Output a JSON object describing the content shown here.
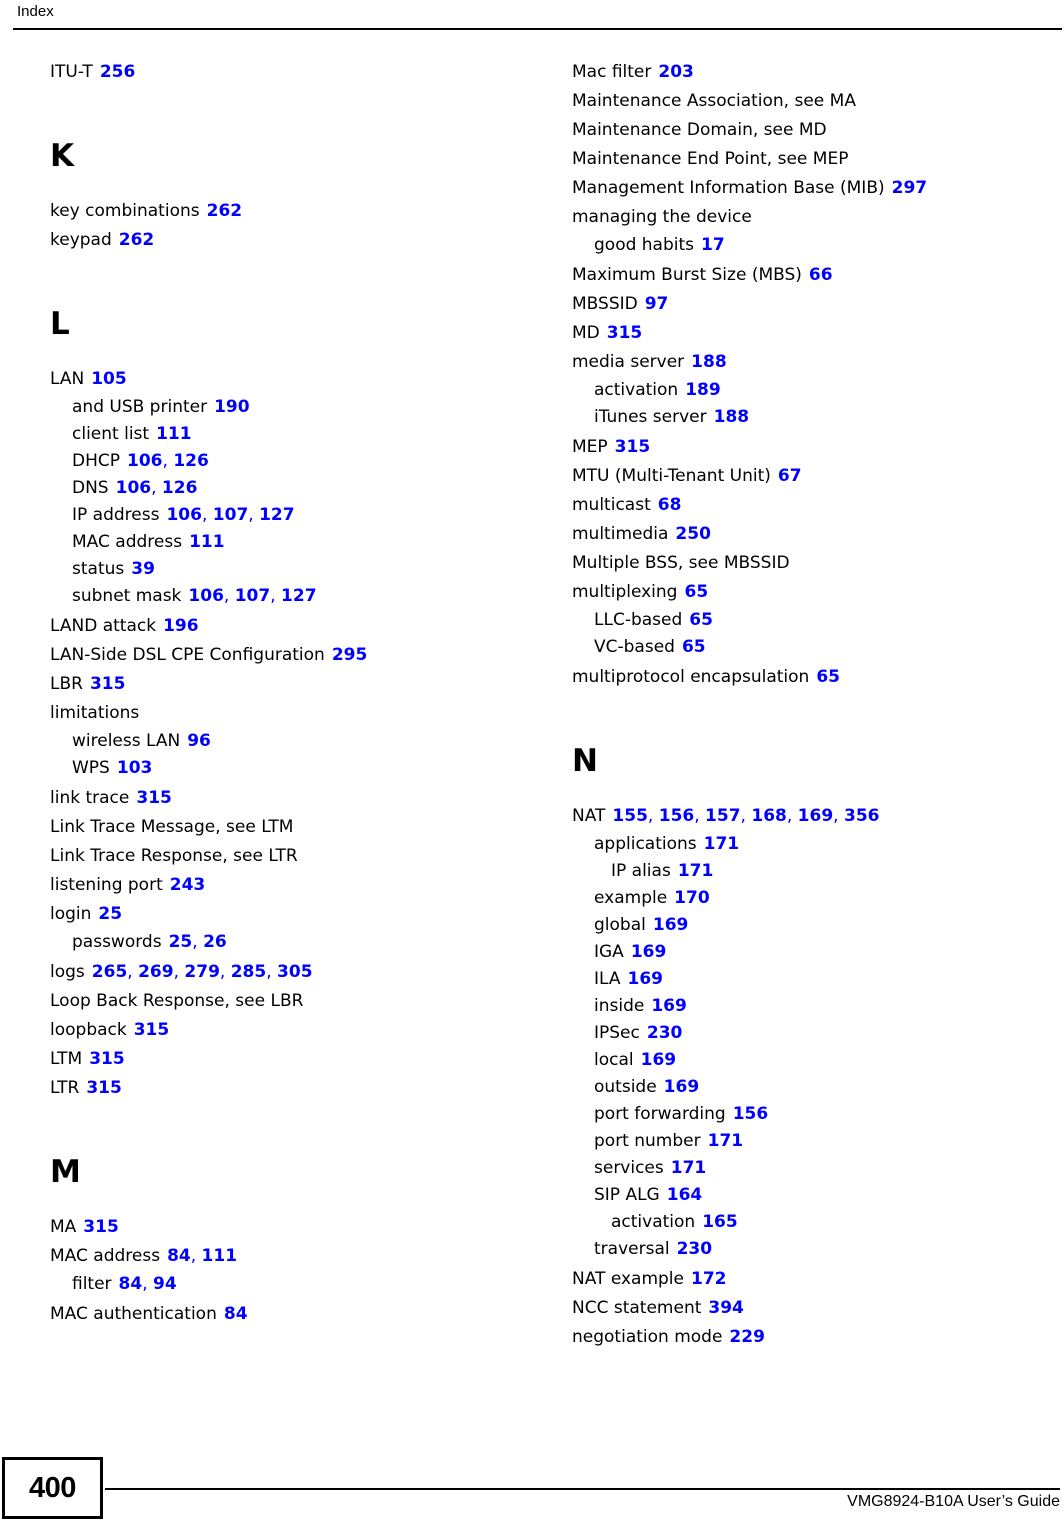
{
  "header": {
    "title": "Index"
  },
  "footer": {
    "page_number": "400",
    "guide_title": "VMG8924-B10A User’s Guide"
  },
  "columns": [
    {
      "name": "left-column",
      "blocks": [
        {
          "type": "entries",
          "entries": [
            {
              "level": 0,
              "term": "ITU-T",
              "refs": [
                "256"
              ]
            }
          ]
        },
        {
          "type": "letter",
          "letter": "K",
          "entries": [
            {
              "level": 0,
              "term": "key combinations",
              "refs": [
                "262"
              ]
            },
            {
              "level": 0,
              "term": "keypad",
              "refs": [
                "262"
              ]
            }
          ]
        },
        {
          "type": "letter",
          "letter": "L",
          "entries": [
            {
              "level": 0,
              "term": "LAN",
              "refs": [
                "105"
              ]
            },
            {
              "level": 1,
              "term": "and USB printer",
              "refs": [
                "190"
              ]
            },
            {
              "level": 1,
              "term": "client list",
              "refs": [
                "111"
              ]
            },
            {
              "level": 1,
              "term": "DHCP",
              "refs": [
                "106",
                "126"
              ]
            },
            {
              "level": 1,
              "term": "DNS",
              "refs": [
                "106",
                "126"
              ]
            },
            {
              "level": 1,
              "term": "IP address",
              "refs": [
                "106",
                "107",
                "127"
              ]
            },
            {
              "level": 1,
              "term": "MAC address",
              "refs": [
                "111"
              ]
            },
            {
              "level": 1,
              "term": "status",
              "refs": [
                "39"
              ]
            },
            {
              "level": 1,
              "term": "subnet mask",
              "refs": [
                "106",
                "107",
                "127"
              ]
            },
            {
              "level": 0,
              "term": "LAND attack",
              "refs": [
                "196"
              ]
            },
            {
              "level": 0,
              "term": "LAN-Side DSL CPE Configuration",
              "refs": [
                "295"
              ]
            },
            {
              "level": 0,
              "term": "LBR",
              "refs": [
                "315"
              ]
            },
            {
              "level": 0,
              "term": "limitations",
              "refs": []
            },
            {
              "level": 1,
              "term": "wireless LAN",
              "refs": [
                "96"
              ]
            },
            {
              "level": 1,
              "term": "WPS",
              "refs": [
                "103"
              ]
            },
            {
              "level": 0,
              "term": "link trace",
              "refs": [
                "315"
              ]
            },
            {
              "level": 0,
              "term": "Link Trace Message, see LTM",
              "refs": []
            },
            {
              "level": 0,
              "term": "Link Trace Response, see LTR",
              "refs": []
            },
            {
              "level": 0,
              "term": "listening port",
              "refs": [
                "243"
              ]
            },
            {
              "level": 0,
              "term": "login",
              "refs": [
                "25"
              ]
            },
            {
              "level": 1,
              "term": "passwords",
              "refs": [
                "25",
                "26"
              ]
            },
            {
              "level": 0,
              "term": "logs",
              "refs": [
                "265",
                "269",
                "279",
                "285",
                "305"
              ]
            },
            {
              "level": 0,
              "term": "Loop Back Response, see LBR",
              "refs": []
            },
            {
              "level": 0,
              "term": "loopback",
              "refs": [
                "315"
              ]
            },
            {
              "level": 0,
              "term": "LTM",
              "refs": [
                "315"
              ]
            },
            {
              "level": 0,
              "term": "LTR",
              "refs": [
                "315"
              ]
            }
          ]
        },
        {
          "type": "letter",
          "letter": "M",
          "entries": [
            {
              "level": 0,
              "term": "MA",
              "refs": [
                "315"
              ]
            },
            {
              "level": 0,
              "term": "MAC address",
              "refs": [
                "84",
                "111"
              ]
            },
            {
              "level": 1,
              "term": "filter",
              "refs": [
                "84",
                "94"
              ]
            },
            {
              "level": 0,
              "term": "MAC authentication",
              "refs": [
                "84"
              ]
            }
          ]
        }
      ]
    },
    {
      "name": "right-column",
      "blocks": [
        {
          "type": "entries",
          "entries": [
            {
              "level": 0,
              "term": "Mac filter",
              "refs": [
                "203"
              ]
            },
            {
              "level": 0,
              "term": "Maintenance Association, see MA",
              "refs": []
            },
            {
              "level": 0,
              "term": "Maintenance Domain, see MD",
              "refs": []
            },
            {
              "level": 0,
              "term": "Maintenance End Point, see MEP",
              "refs": []
            },
            {
              "level": 0,
              "term": "Management Information Base (MIB)",
              "refs": [
                "297"
              ]
            },
            {
              "level": 0,
              "term": "managing the device",
              "refs": []
            },
            {
              "level": 1,
              "term": "good habits",
              "refs": [
                "17"
              ]
            },
            {
              "level": 0,
              "term": "Maximum Burst Size (MBS)",
              "refs": [
                "66"
              ]
            },
            {
              "level": 0,
              "term": "MBSSID",
              "refs": [
                "97"
              ]
            },
            {
              "level": 0,
              "term": "MD",
              "refs": [
                "315"
              ]
            },
            {
              "level": 0,
              "term": "media server",
              "refs": [
                "188"
              ]
            },
            {
              "level": 1,
              "term": "activation",
              "refs": [
                "189"
              ]
            },
            {
              "level": 1,
              "term": "iTunes server",
              "refs": [
                "188"
              ]
            },
            {
              "level": 0,
              "term": "MEP",
              "refs": [
                "315"
              ]
            },
            {
              "level": 0,
              "term": "MTU (Multi-Tenant Unit)",
              "refs": [
                "67"
              ]
            },
            {
              "level": 0,
              "term": "multicast",
              "refs": [
                "68"
              ]
            },
            {
              "level": 0,
              "term": "multimedia",
              "refs": [
                "250"
              ]
            },
            {
              "level": 0,
              "term": "Multiple BSS, see MBSSID",
              "refs": []
            },
            {
              "level": 0,
              "term": "multiplexing",
              "refs": [
                "65"
              ]
            },
            {
              "level": 1,
              "term": "LLC-based",
              "refs": [
                "65"
              ]
            },
            {
              "level": 1,
              "term": "VC-based",
              "refs": [
                "65"
              ]
            },
            {
              "level": 0,
              "term": "multiprotocol encapsulation",
              "refs": [
                "65"
              ]
            }
          ]
        },
        {
          "type": "letter",
          "letter": "N",
          "entries": [
            {
              "level": 0,
              "term": "NAT",
              "refs": [
                "155",
                "156",
                "157",
                "168",
                "169",
                "356"
              ]
            },
            {
              "level": 1,
              "term": "applications",
              "refs": [
                "171"
              ]
            },
            {
              "level": 2,
              "term": "IP alias",
              "refs": [
                "171"
              ]
            },
            {
              "level": 1,
              "term": "example",
              "refs": [
                "170"
              ]
            },
            {
              "level": 1,
              "term": "global",
              "refs": [
                "169"
              ]
            },
            {
              "level": 1,
              "term": "IGA",
              "refs": [
                "169"
              ]
            },
            {
              "level": 1,
              "term": "ILA",
              "refs": [
                "169"
              ]
            },
            {
              "level": 1,
              "term": "inside",
              "refs": [
                "169"
              ]
            },
            {
              "level": 1,
              "term": "IPSec",
              "refs": [
                "230"
              ]
            },
            {
              "level": 1,
              "term": "local",
              "refs": [
                "169"
              ]
            },
            {
              "level": 1,
              "term": "outside",
              "refs": [
                "169"
              ]
            },
            {
              "level": 1,
              "term": "port forwarding",
              "refs": [
                "156"
              ]
            },
            {
              "level": 1,
              "term": "port number",
              "refs": [
                "171"
              ]
            },
            {
              "level": 1,
              "term": "services",
              "refs": [
                "171"
              ]
            },
            {
              "level": 1,
              "term": "SIP ALG",
              "refs": [
                "164"
              ]
            },
            {
              "level": 2,
              "term": "activation",
              "refs": [
                "165"
              ]
            },
            {
              "level": 1,
              "term": "traversal",
              "refs": [
                "230"
              ]
            },
            {
              "level": 0,
              "term": "NAT example",
              "refs": [
                "172"
              ]
            },
            {
              "level": 0,
              "term": "NCC statement",
              "refs": [
                "394"
              ]
            },
            {
              "level": 0,
              "term": "negotiation mode",
              "refs": [
                "229"
              ]
            }
          ]
        }
      ]
    }
  ]
}
